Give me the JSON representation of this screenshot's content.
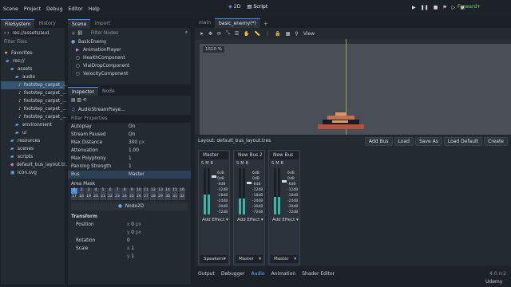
{
  "menu": [
    "Scene",
    "Project",
    "Debug",
    "Editor",
    "Help"
  ],
  "workspaces": {
    "two_d": "2D",
    "script": "Script"
  },
  "renderer": "Forward+",
  "filesystem": {
    "tabs": [
      "FileSystem",
      "History"
    ],
    "path": "res://assets/audio/",
    "filter": "Filter Files",
    "items": [
      "Favorites:",
      "res://",
      "assets",
      "audio",
      "footstep_carpet_...",
      "footstep_carpet_...",
      "footstep_carpet_...",
      "footstep_carpet_...",
      "footstep_carpet_...",
      "environment",
      "ui",
      "resources",
      "scenes",
      "scripts",
      "default_bus_layout.tr...",
      "icon.svg"
    ]
  },
  "scene": {
    "tabs": [
      "Scene",
      "Import"
    ],
    "filter": "Filter Nodes",
    "nodes": [
      "BasicEnemy",
      "AnimationPlayer",
      "HealthComponent",
      "VialDropComponent",
      "VelocityComponent"
    ]
  },
  "inspector": {
    "tabs": [
      "Inspector",
      "Node"
    ],
    "object": "AudioStreamPlaye...",
    "filter": "Filter Properties",
    "props": [
      {
        "label": "Autoplay",
        "value": "On"
      },
      {
        "label": "Stream Paused",
        "value": "On"
      },
      {
        "label": "Max Distance",
        "value": "300",
        "unit": "px"
      },
      {
        "label": "Attenuation",
        "value": "1.00"
      },
      {
        "label": "Max Polyphony",
        "value": "1"
      },
      {
        "label": "Panning Strength",
        "value": "1"
      },
      {
        "label": "Bus",
        "value": "Master"
      }
    ],
    "area_mask": "Area Mask",
    "mask_numbers": [
      "1",
      "2",
      "3",
      "4",
      "5",
      "6",
      "7",
      "8",
      "9",
      "10",
      "11",
      "12",
      "13",
      "14",
      "15",
      "16",
      "17",
      "18",
      "19",
      "20",
      "21",
      "22",
      "23",
      "24",
      "25",
      "26",
      "27",
      "28",
      "29",
      "30",
      "31",
      "32"
    ],
    "node2d": "Node2D",
    "transform": "Transform",
    "position": "Position",
    "pos_x": "0",
    "pos_y": "0",
    "px": "px",
    "rotation": "Rotation",
    "rot": "0",
    "scale": "Scale",
    "sx": "1",
    "sy": "1"
  },
  "editor_tabs": [
    "main",
    "basic_enemy(*)"
  ],
  "toolbar_view": "View",
  "zoom": "1510 %",
  "audio": {
    "layout": "Layout: default_bus_layout.tres",
    "buttons": [
      "Add Bus",
      "Load",
      "Save As",
      "Load Default",
      "Create"
    ],
    "buses": [
      {
        "name": "Master",
        "db_top": "0dB",
        "out": "Speakers",
        "fader_level": 0.85
      },
      {
        "name": "New Bus 2",
        "db_top": "0dB",
        "out": "Master",
        "fader_level": 0.7
      },
      {
        "name": "New Bus",
        "db_top": "0dB",
        "out": "Master",
        "fader_level": 0.75
      }
    ],
    "db_ticks": [
      "6dB",
      "0dB",
      "-6dB",
      "-12dB",
      "-18dB",
      "-24dB",
      "-30dB",
      "-72dB"
    ],
    "add_effect": "Add Effect",
    "sms": [
      "S",
      "M",
      "B"
    ]
  },
  "bottom_tabs": [
    "Output",
    "Debugger",
    "Audio",
    "Animation",
    "Shader Editor"
  ],
  "version": "4.0.rc2",
  "watermark": "Udemy"
}
